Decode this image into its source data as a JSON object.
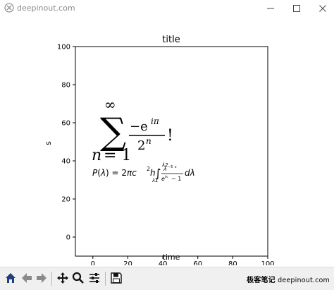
{
  "window": {
    "title": "deepinout.com"
  },
  "chart_data": {
    "type": "scatter",
    "title": "title",
    "xlabel": "time",
    "ylabel": "s",
    "xlim": [
      -10,
      100
    ],
    "ylim": [
      -10,
      100
    ],
    "x_ticks": [
      "0",
      "20",
      "40",
      "60",
      "80",
      "100"
    ],
    "y_ticks": [
      "0",
      "20",
      "40",
      "60",
      "80",
      "100"
    ],
    "grid": false,
    "annotations": [
      {
        "text": "sum_{n=1}^{infinity} -e^{i pi} / 2^n !",
        "x": 0,
        "y": 40
      },
      {
        "text": "P(lambda) = 2 pi c^2 h integral_{lambda1}^{lambda2} lambda^{-5} / (e^{hc / lambda k T} - 1) d lambda",
        "x": 0,
        "y": 20
      }
    ]
  },
  "toolbar": {
    "buttons": [
      "home-icon",
      "back-arrow-icon",
      "forward-arrow-icon",
      "pan-icon",
      "zoom-icon",
      "configure-subplots-icon",
      "save-icon"
    ],
    "watermark_cn": "极客笔记",
    "watermark_url": "deepinout.com"
  }
}
